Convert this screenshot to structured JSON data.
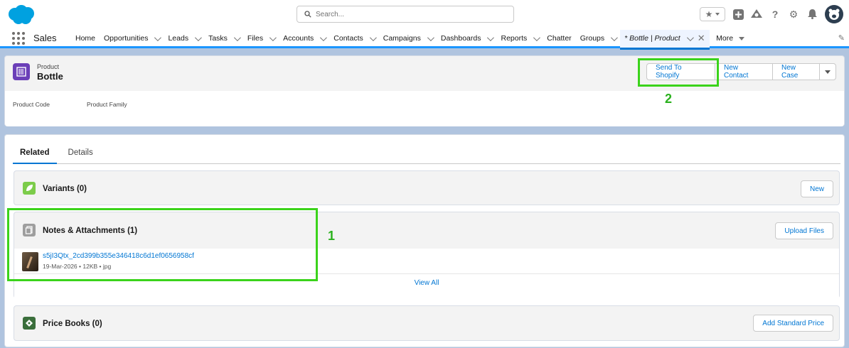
{
  "header": {
    "search_placeholder": "Search...",
    "icons": [
      "star-icon",
      "add-icon",
      "trailhead-icon",
      "help-icon",
      "setup-icon",
      "bell-icon",
      "avatar"
    ]
  },
  "nav": {
    "app_name": "Sales",
    "items": [
      {
        "label": "Home",
        "dropdown": false
      },
      {
        "label": "Opportunities",
        "dropdown": true
      },
      {
        "label": "Leads",
        "dropdown": true
      },
      {
        "label": "Tasks",
        "dropdown": true
      },
      {
        "label": "Files",
        "dropdown": true
      },
      {
        "label": "Accounts",
        "dropdown": true
      },
      {
        "label": "Contacts",
        "dropdown": true
      },
      {
        "label": "Campaigns",
        "dropdown": true
      },
      {
        "label": "Dashboards",
        "dropdown": true
      },
      {
        "label": "Reports",
        "dropdown": true
      },
      {
        "label": "Chatter",
        "dropdown": false
      },
      {
        "label": "Groups",
        "dropdown": true
      }
    ],
    "active_tab": "* Bottle | Product",
    "more": "More"
  },
  "record": {
    "object_label": "Product",
    "name": "Bottle",
    "actions": {
      "send_to_shopify": "Send To Shopify",
      "new_contact": "New Contact",
      "new_case": "New Case"
    },
    "fields": {
      "product_code": "Product Code",
      "product_family": "Product Family"
    }
  },
  "annotations": {
    "one": "1",
    "two": "2",
    "color": "#3bd31b"
  },
  "tabs": {
    "related": "Related",
    "details": "Details"
  },
  "variants": {
    "title": "Variants (0)",
    "button": "New"
  },
  "notes": {
    "title": "Notes & Attachments (1)",
    "button": "Upload Files",
    "file_name": "s5jI3Qtx_2cd399b355e346418c6d1ef0656958cf",
    "file_meta": "19-Mar-2026 • 12KB • jpg",
    "view_all": "View All"
  },
  "price_books": {
    "title": "Price Books (0)",
    "button": "Add Standard Price"
  },
  "colors": {
    "brand": "#0176d3",
    "product_icon": "#6b3fb8",
    "variants_icon": "#7ccc4a",
    "notes_icon": "#9e9e9e",
    "pricebook_icon": "#3a6e3b"
  }
}
